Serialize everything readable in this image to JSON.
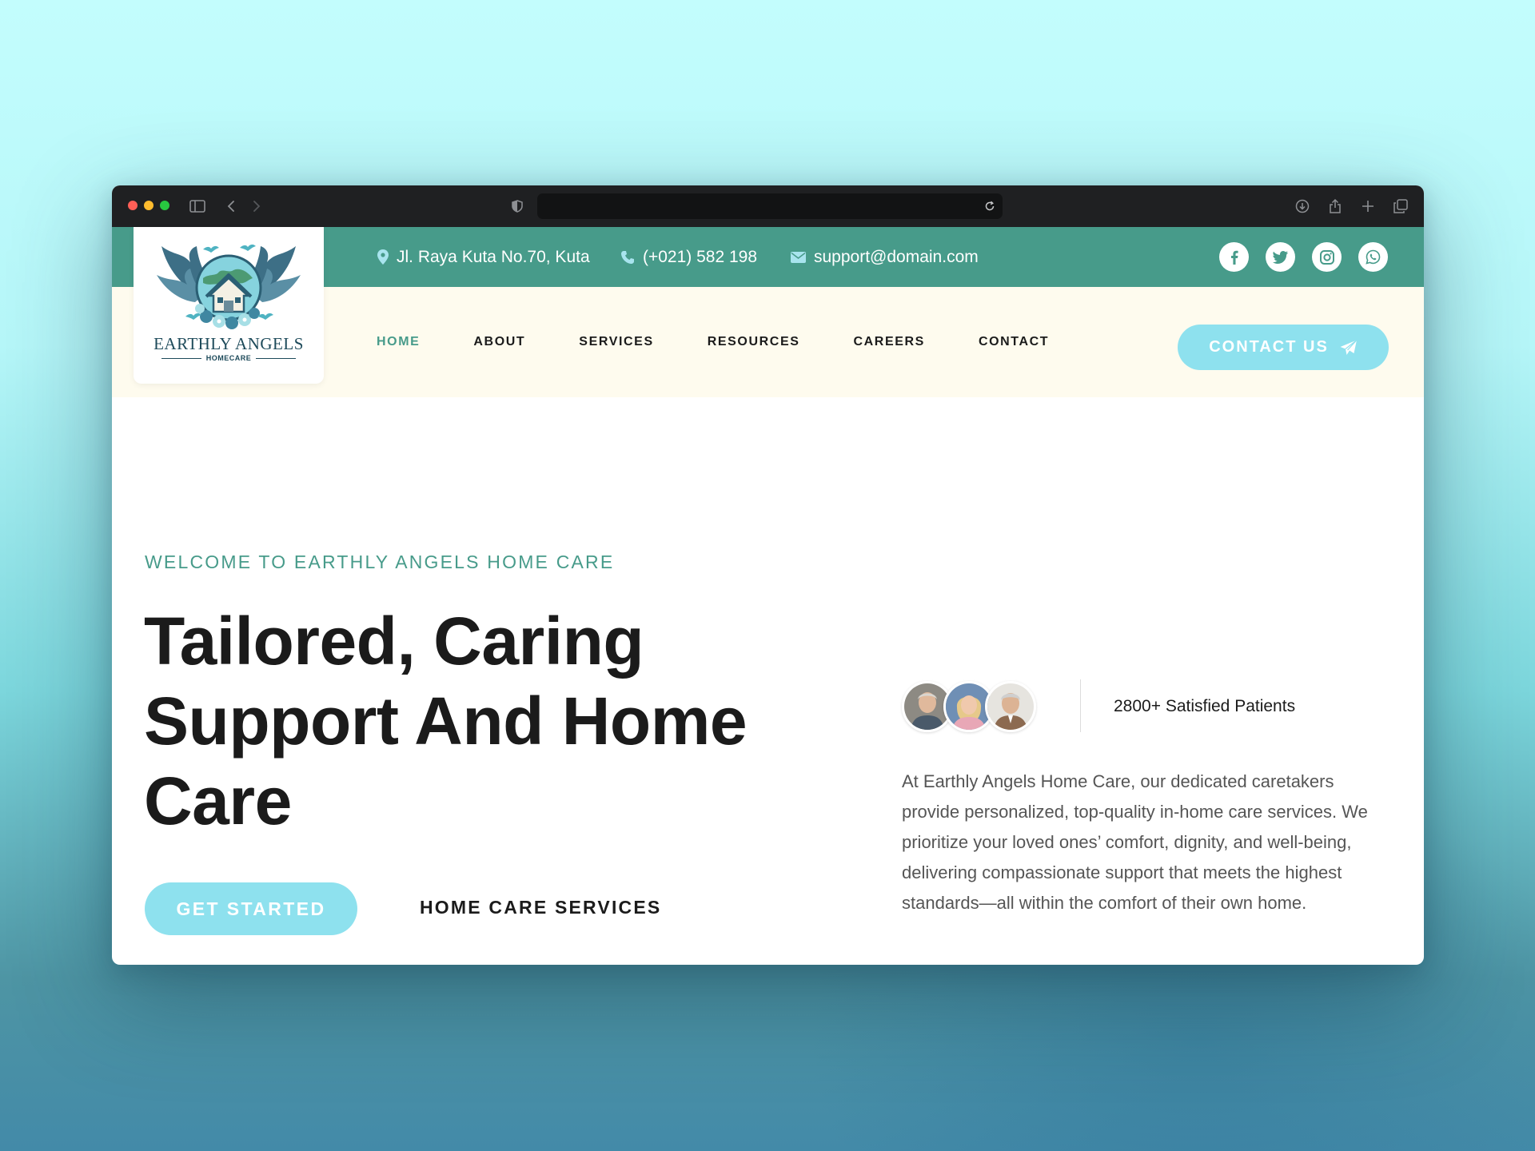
{
  "browser": {
    "url": ""
  },
  "topbar": {
    "address": "Jl. Raya Kuta No.70, Kuta",
    "phone": "(+021) 582 198",
    "email": "support@domain.com",
    "socials": [
      "facebook-icon",
      "twitter-icon",
      "instagram-icon",
      "whatsapp-icon"
    ]
  },
  "logo": {
    "name": "EARTHLY ANGELS",
    "sub": "HOMECARE"
  },
  "nav": {
    "items": [
      {
        "label": "HOME",
        "active": true
      },
      {
        "label": "ABOUT",
        "active": false
      },
      {
        "label": "SERVICES",
        "active": false
      },
      {
        "label": "RESOURCES",
        "active": false
      },
      {
        "label": "CAREERS",
        "active": false
      },
      {
        "label": "CONTACT",
        "active": false
      }
    ],
    "cta_label": "CONTACT US"
  },
  "hero": {
    "eyebrow": "WELCOME TO EARTHLY ANGELS HOME CARE",
    "title": "Tailored, Caring Support And Home Care",
    "primary_button": "GET STARTED",
    "secondary_link": "HOME CARE SERVICES",
    "patients": "2800+ Satisfied Patients",
    "description": "At Earthly Angels Home Care, our dedicated caretakers provide personalized, top-quality in-home care services. We prioritize your loved ones’ comfort, dignity, and well-being, delivering compassionate support that meets the highest standards—all within the comfort of their own home."
  },
  "colors": {
    "teal": "#479b8a",
    "cream": "#fefbee",
    "cyan_button": "#8ee1ee",
    "dark_text": "#1b1b1b"
  }
}
